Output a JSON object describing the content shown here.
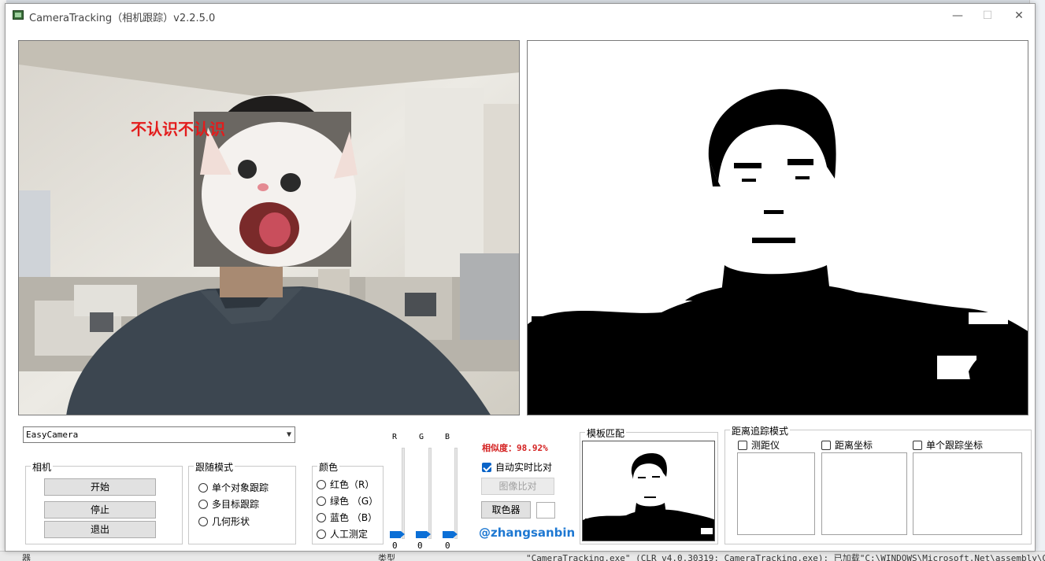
{
  "window": {
    "title": "CameraTracking（相机跟踪）v2.2.5.0",
    "minimize_glyph": "—",
    "maximize_glyph": "☐",
    "close_glyph": "✕"
  },
  "overlay": {
    "label": "不认识不认识"
  },
  "camera_select": {
    "value": "EasyCamera"
  },
  "camera_group": {
    "title": "相机",
    "buttons": [
      "开始",
      "停止",
      "退出"
    ]
  },
  "follow_mode": {
    "title": "跟随模式",
    "options": [
      "单个对象跟踪",
      "多目标跟踪",
      "几何形状"
    ]
  },
  "color_group": {
    "title": "颜色",
    "options": [
      "红色（R）",
      "绿色 （G）",
      "蓝色 （B）",
      "人工测定"
    ]
  },
  "sliders": [
    {
      "label": "R",
      "value": "0"
    },
    {
      "label": "G",
      "value": "0"
    },
    {
      "label": "B",
      "value": "0"
    }
  ],
  "compare": {
    "similarity": "相似度：98.92%",
    "auto_compare_label": "自动实时比对",
    "auto_compare_checked": true,
    "image_compare_button": "图像比对",
    "color_picker_button": "取色器",
    "author": "@zhangsanbin"
  },
  "template_match": {
    "title": "模板匹配"
  },
  "distance_mode": {
    "title": "距离追踪模式",
    "options": [
      "测距仪",
      "距离坐标",
      "单个跟踪坐标"
    ]
  },
  "background": {
    "console_text": "\"CameraTracking.exe\" (CLR v4.0.30319: CameraTracking.exe): 已加载\"C:\\WINDOWS\\Microsoft.Net\\assembly\\GAC_MSIL\\",
    "bottom_left_text": "器",
    "bottom_mid_text": "类型"
  },
  "colors": {
    "accent": "#0b6fd6",
    "similarity_red": "#d42020",
    "author_blue": "#1e78d2"
  }
}
